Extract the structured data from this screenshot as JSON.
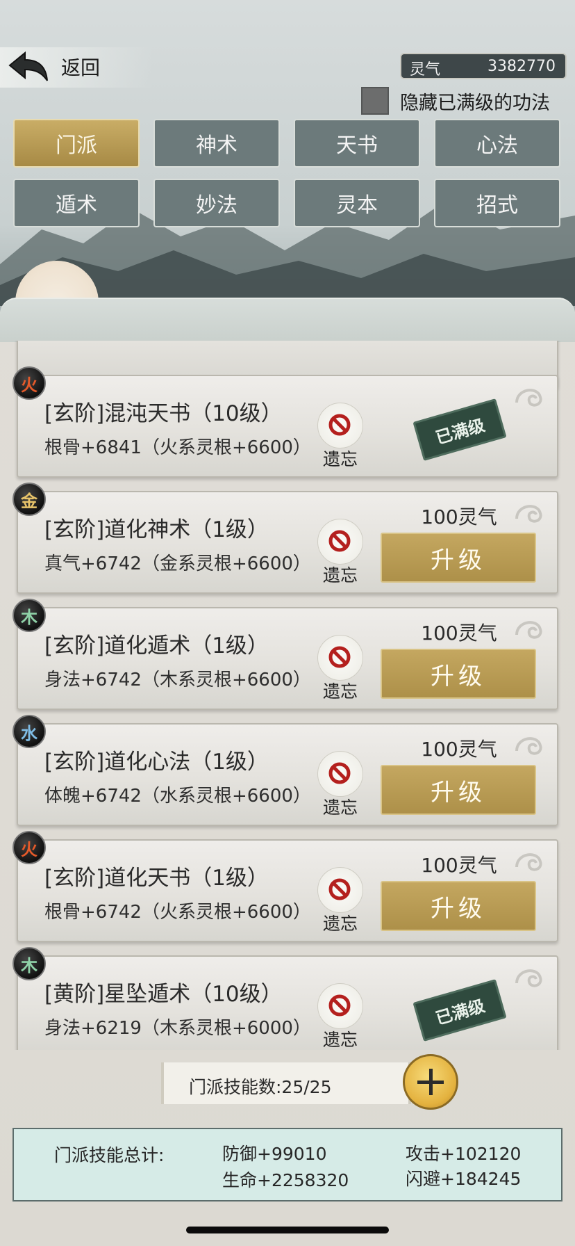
{
  "header": {
    "back_label": "返回",
    "qi_label": "灵气",
    "qi_value": "3382770"
  },
  "filter": {
    "hide_maxed_label": "隐藏已满级的功法",
    "checked": false
  },
  "tabs": [
    {
      "label": "门派",
      "active": true
    },
    {
      "label": "神术",
      "active": false
    },
    {
      "label": "天书",
      "active": false
    },
    {
      "label": "心法",
      "active": false
    },
    {
      "label": "遁术",
      "active": false
    },
    {
      "label": "妙法",
      "active": false
    },
    {
      "label": "灵本",
      "active": false
    },
    {
      "label": "招式",
      "active": false
    }
  ],
  "skills": [
    {
      "element": "火",
      "element_type": "fire",
      "name": "[玄阶]混沌天书（10级）",
      "bonus": "根骨+6841（火系灵根+6600）",
      "forget_label": "遗忘",
      "maxed": true,
      "maxed_label": "已满级"
    },
    {
      "element": "金",
      "element_type": "metal",
      "name": "[玄阶]道化神术（1级）",
      "bonus": "真气+6742（金系灵根+6600）",
      "forget_label": "遗忘",
      "maxed": false,
      "cost": "100灵气",
      "upgrade_label": "升级"
    },
    {
      "element": "木",
      "element_type": "wood",
      "name": "[玄阶]道化遁术（1级）",
      "bonus": "身法+6742（木系灵根+6600）",
      "forget_label": "遗忘",
      "maxed": false,
      "cost": "100灵气",
      "upgrade_label": "升级"
    },
    {
      "element": "水",
      "element_type": "water",
      "name": "[玄阶]道化心法（1级）",
      "bonus": "体魄+6742（水系灵根+6600）",
      "forget_label": "遗忘",
      "maxed": false,
      "cost": "100灵气",
      "upgrade_label": "升级"
    },
    {
      "element": "火",
      "element_type": "fire",
      "name": "[玄阶]道化天书（1级）",
      "bonus": "根骨+6742（火系灵根+6600）",
      "forget_label": "遗忘",
      "maxed": false,
      "cost": "100灵气",
      "upgrade_label": "升级"
    },
    {
      "element": "木",
      "element_type": "wood",
      "name": "[黄阶]星坠遁术（10级）",
      "bonus": "身法+6219（木系灵根+6000）",
      "forget_label": "遗忘",
      "maxed": true,
      "maxed_label": "已满级"
    }
  ],
  "skill_count": {
    "label": "门派技能数:25/25"
  },
  "summary": {
    "title": "门派技能总计:",
    "defense": "防御+99010",
    "attack": "攻击+102120",
    "life": "生命+2258320",
    "dodge": "闪避+184245"
  }
}
